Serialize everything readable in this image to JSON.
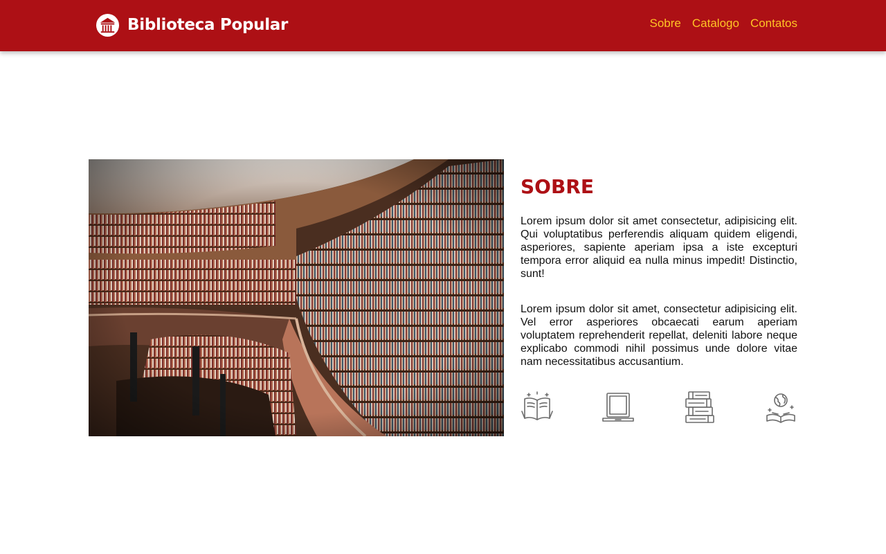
{
  "header": {
    "brand": "Biblioteca Popular",
    "logo_icon": "library-columns-icon",
    "nav": [
      {
        "label": "Sobre"
      },
      {
        "label": "Catalogo"
      },
      {
        "label": "Contatos"
      }
    ]
  },
  "about": {
    "image_icon": "library-bookshelves-photo",
    "title": "SOBRE",
    "paragraphs": [
      "Lorem ipsum dolor sit amet consectetur, adipisicing elit. Qui voluptatibus perferendis aliquam quidem eligendi, asperiores, sapiente aperiam ipsa a iste excepturi tempora error aliquid ea nulla minus impedit! Distinctio, sunt!",
      "Lorem ipsum dolor sit amet, consectetur adipisicing elit. Vel error asperiores obcaecati earum aperiam voluptatem reprehenderit repellat, deleniti labore neque explicabo commodi nihil possimus unde dolore vitae nam necessitatibus accusantium."
    ],
    "feature_icons": [
      "reading-book-icon",
      "laptop-icon",
      "book-stack-icon",
      "open-book-globe-icon"
    ]
  },
  "colors": {
    "primary": "#ad1015",
    "nav_link": "#ffc425",
    "icon_gray": "#6b6b6b"
  }
}
